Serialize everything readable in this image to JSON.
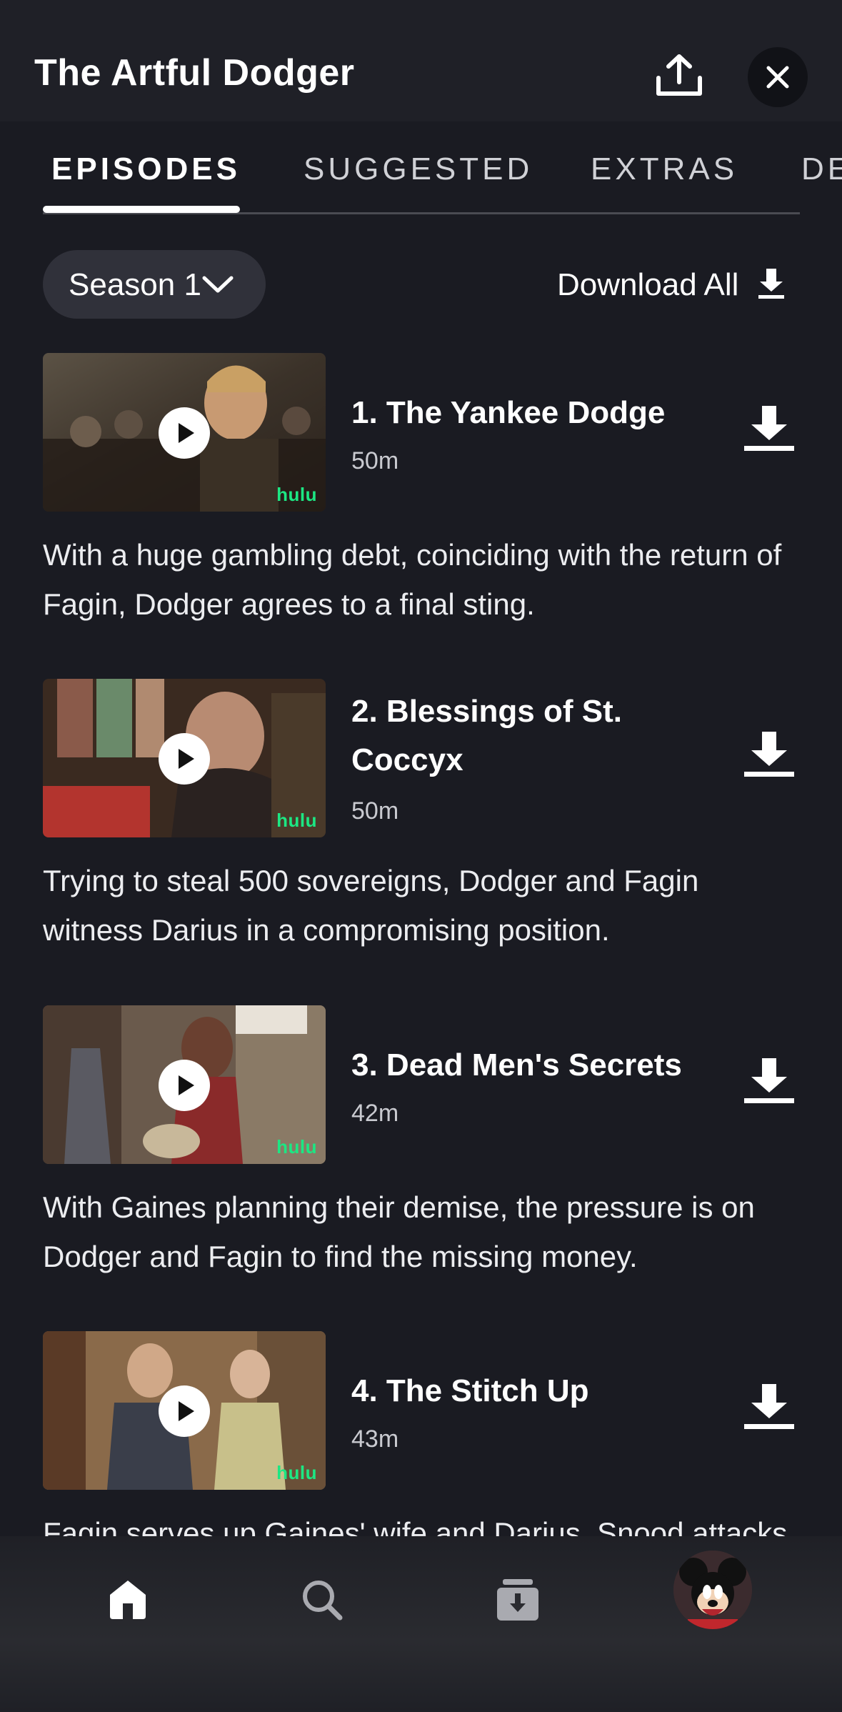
{
  "header": {
    "title": "The Artful Dodger",
    "share_icon": "share-upload-icon",
    "close_icon": "close-icon"
  },
  "tabs": [
    {
      "label": "EPISODES",
      "active": true
    },
    {
      "label": "SUGGESTED",
      "active": false
    },
    {
      "label": "EXTRAS",
      "active": false
    },
    {
      "label": "DE",
      "active": false
    }
  ],
  "controls": {
    "season_label": "Season 1",
    "download_all_label": "Download All"
  },
  "episodes": [
    {
      "title": "1. The Yankee Dodge",
      "duration": "50m",
      "description": "With a huge gambling debt, coinciding with the return of Fagin, Dodger agrees to a final sting.",
      "badge": "hulu"
    },
    {
      "title": "2. Blessings of St. Coccyx",
      "duration": "50m",
      "description": "Trying to steal 500 sovereigns, Dodger and Fagin witness Darius in a compromising position.",
      "badge": "hulu"
    },
    {
      "title": "3. Dead Men's Secrets",
      "duration": "42m",
      "description": "With Gaines planning their demise, the pressure is on Dodger and Fagin to find the missing money.",
      "badge": "hulu"
    },
    {
      "title": "4. The Stitch Up",
      "duration": "43m",
      "description": "Fagin serves up Gaines' wife and Darius. Snood attacks",
      "badge": "hulu"
    }
  ],
  "nav": [
    {
      "icon": "home-icon"
    },
    {
      "icon": "search-icon"
    },
    {
      "icon": "downloads-icon"
    },
    {
      "icon": "profile-avatar"
    }
  ],
  "colors": {
    "background": "#1a1b22",
    "accent_hulu": "#1ce783",
    "text": "#ffffff"
  }
}
